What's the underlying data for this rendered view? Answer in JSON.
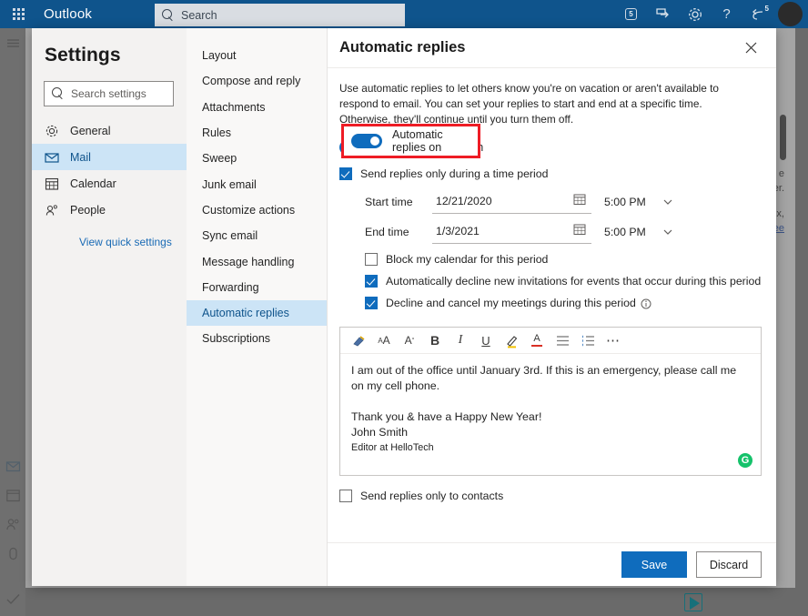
{
  "topbar": {
    "brand": "Outlook",
    "waffle_icon": "app-launcher-icon",
    "search_placeholder": "Search",
    "search_icon": "search-icon",
    "icons": [
      {
        "name": "message-count-badge",
        "label": "5"
      },
      {
        "name": "send-flag-icon",
        "label": ""
      },
      {
        "name": "gear-icon",
        "label": ""
      },
      {
        "name": "help-icon",
        "label": "?"
      },
      {
        "name": "reply-arrow-icon",
        "label": "5"
      }
    ],
    "avatar": "user-avatar"
  },
  "background": {
    "rail_icons": [
      "hamburger-menu-icon",
      "mail-icon",
      "calendar-icon",
      "people-icon",
      "files-icon",
      "tasks-icon"
    ],
    "fragment_lines": [
      "e",
      "cker.",
      "ox,",
      "ee"
    ],
    "play_icon": "play-icon"
  },
  "settings": {
    "title": "Settings",
    "search_placeholder": "Search settings",
    "search_icon": "search-icon",
    "nav": [
      {
        "label": "General",
        "icon": "gear-icon",
        "active": false
      },
      {
        "label": "Mail",
        "icon": "mail-icon",
        "active": true
      },
      {
        "label": "Calendar",
        "icon": "calendar-icon",
        "active": false
      },
      {
        "label": "People",
        "icon": "people-icon",
        "active": false
      }
    ],
    "quick_settings_link": "View quick settings",
    "subnav": [
      {
        "label": "Layout",
        "active": false
      },
      {
        "label": "Compose and reply",
        "active": false
      },
      {
        "label": "Attachments",
        "active": false
      },
      {
        "label": "Rules",
        "active": false
      },
      {
        "label": "Sweep",
        "active": false
      },
      {
        "label": "Junk email",
        "active": false
      },
      {
        "label": "Customize actions",
        "active": false
      },
      {
        "label": "Sync email",
        "active": false
      },
      {
        "label": "Message handling",
        "active": false
      },
      {
        "label": "Forwarding",
        "active": false
      },
      {
        "label": "Automatic replies",
        "active": true
      },
      {
        "label": "Subscriptions",
        "active": false
      }
    ]
  },
  "panel": {
    "title": "Automatic replies",
    "close_icon": "close-icon",
    "description": "Use automatic replies to let others know you're on vacation or aren't available to respond to email. You can set your replies to start and end at a specific time. Otherwise, they'll continue until you turn them off.",
    "toggle": {
      "label": "Automatic replies on",
      "state": "on",
      "accent_color": "#0f6cbd"
    },
    "time_period": {
      "checkbox_label": "Send replies only during a time period",
      "checked": true,
      "start_label": "Start time",
      "start_date": "12/21/2020",
      "start_time": "5:00 PM",
      "end_label": "End time",
      "end_date": "1/3/2021",
      "end_time": "5:00 PM",
      "calendar_icon": "calendar-icon",
      "chevron_icon": "chevron-down-icon"
    },
    "options": [
      {
        "label": "Block my calendar for this period",
        "checked": false,
        "info": false
      },
      {
        "label": "Automatically decline new invitations for events that occur during this period",
        "checked": true,
        "info": false
      },
      {
        "label": "Decline and cancel my meetings during this period",
        "checked": true,
        "info": true
      }
    ],
    "editor": {
      "toolbar": [
        {
          "name": "format-painter-icon",
          "glyph": "brush"
        },
        {
          "name": "increase-font-size-icon",
          "glyph": "AA"
        },
        {
          "name": "decrease-font-size-icon",
          "glyph": "A"
        },
        {
          "name": "bold-icon",
          "glyph": "B"
        },
        {
          "name": "italic-icon",
          "glyph": "I"
        },
        {
          "name": "underline-icon",
          "glyph": "U"
        },
        {
          "name": "highlight-icon",
          "glyph": "pen"
        },
        {
          "name": "font-color-icon",
          "glyph": "A"
        },
        {
          "name": "bulleted-list-icon",
          "glyph": "list"
        },
        {
          "name": "numbered-list-icon",
          "glyph": "numlist"
        },
        {
          "name": "more-options-icon",
          "glyph": "..."
        }
      ],
      "body_paragraph": "I am out of the office until January 3rd. If this is an emergency, please call me on my cell phone.",
      "signoff": "Thank you & have a Happy New Year!",
      "name": "John Smith",
      "title_line": "Editor at HelloTech",
      "grammarly_icon": "grammarly-icon",
      "grammarly_glyph": "G",
      "grammarly_color": "#15c26b"
    },
    "contacts_only": {
      "label": "Send replies only to contacts",
      "checked": false
    },
    "footer": {
      "save_label": "Save",
      "discard_label": "Discard"
    }
  },
  "annotation": {
    "highlight_color": "#ee1c25",
    "target": "automatic-replies-toggle"
  }
}
